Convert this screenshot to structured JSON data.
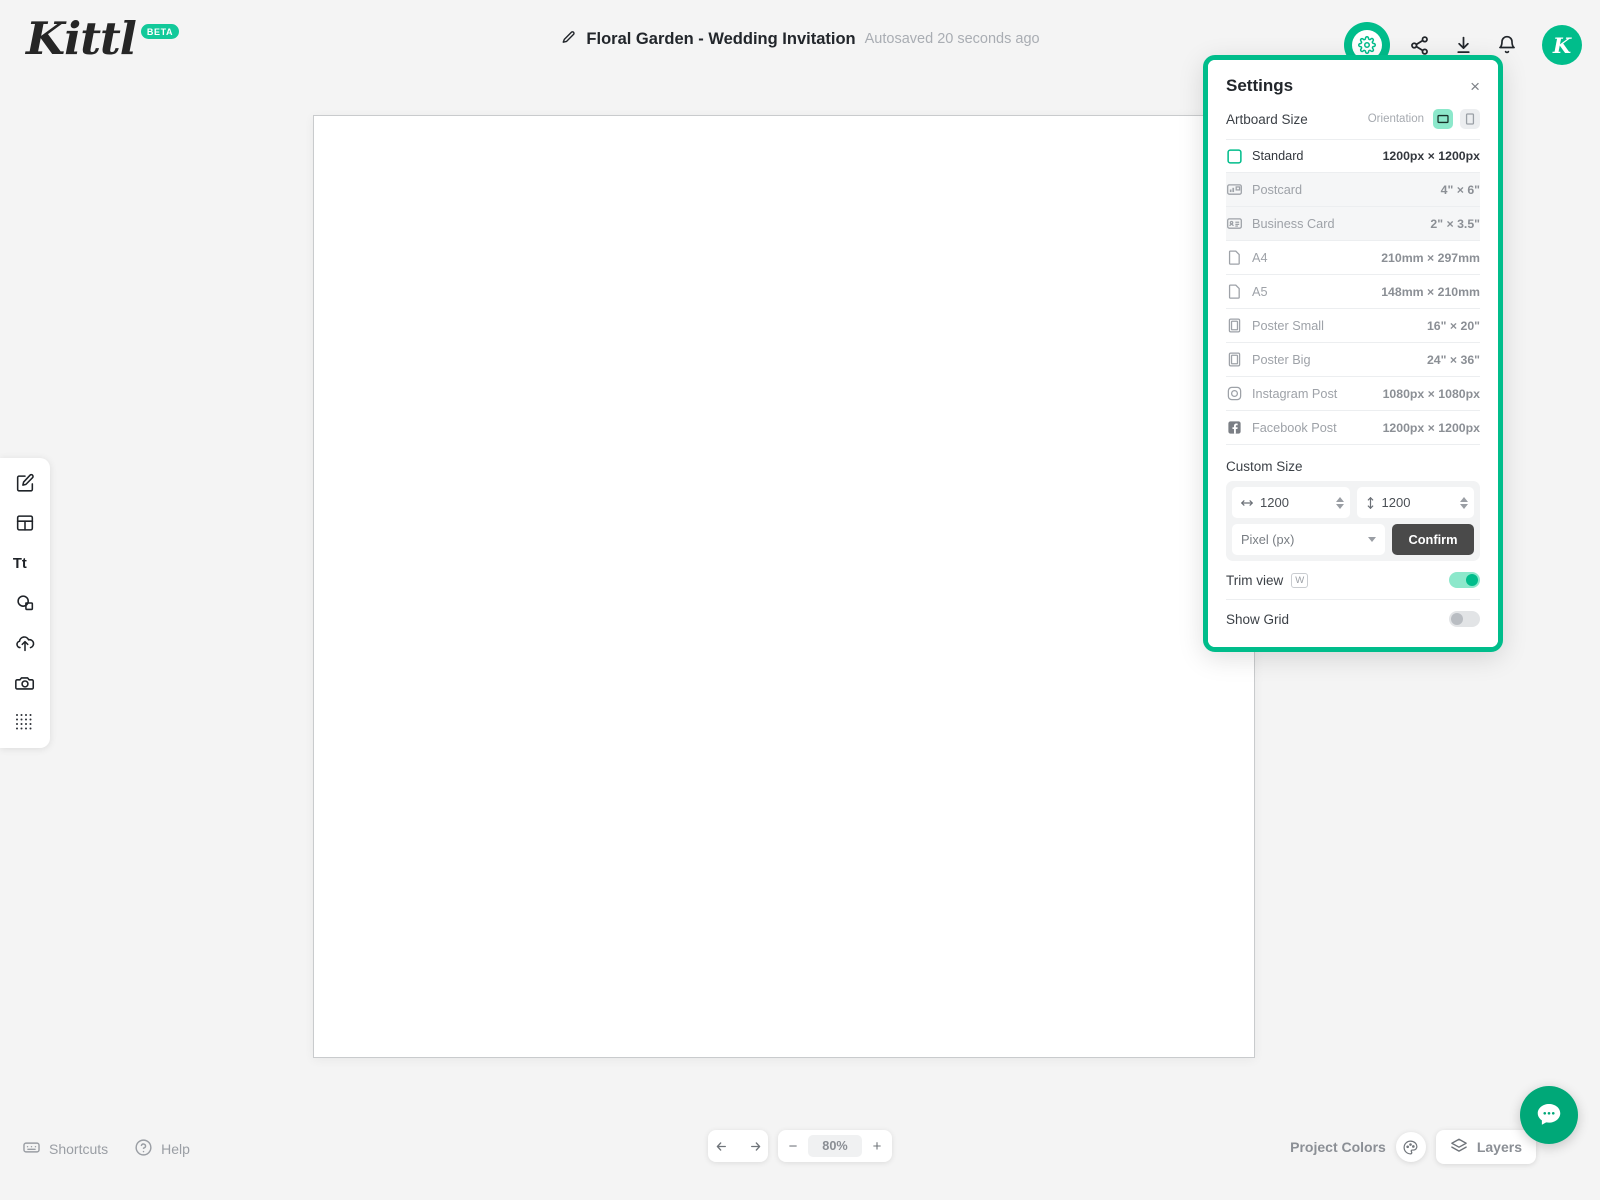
{
  "app": {
    "logo_text": "Kittl",
    "logo_badge": "BETA",
    "accent_color": "#00bd8b",
    "accent_light": "#8ce8cb"
  },
  "header": {
    "doc_title": "Floral Garden - Wedding Invitation",
    "autosave_status": "Autosaved 20 seconds ago",
    "edit_icon": "pencil-icon",
    "actions": [
      {
        "name": "settings-gear-icon",
        "label": "Settings"
      },
      {
        "name": "share-icon",
        "label": "Share"
      },
      {
        "name": "download-icon",
        "label": "Download"
      },
      {
        "name": "notifications-bell-icon",
        "label": "Notifications"
      }
    ],
    "avatar_initial": "K"
  },
  "left_toolbar": {
    "items": [
      {
        "name": "design-edit-icon",
        "label": "Design"
      },
      {
        "name": "templates-icon",
        "label": "Templates"
      },
      {
        "name": "text-icon",
        "label": "Text"
      },
      {
        "name": "elements-shapes-icon",
        "label": "Elements"
      },
      {
        "name": "upload-icon",
        "label": "Uploads"
      },
      {
        "name": "photos-camera-icon",
        "label": "Photos"
      },
      {
        "name": "patterns-grid-icon",
        "label": "Patterns"
      }
    ]
  },
  "settings_panel": {
    "title": "Settings",
    "close_label": "×",
    "artboard_size_label": "Artboard Size",
    "orientation_label": "Orientation",
    "orientation_options": [
      {
        "name": "orientation-landscape",
        "active": true
      },
      {
        "name": "orientation-portrait",
        "active": false
      }
    ],
    "sizes": [
      {
        "icon": "square-icon",
        "name": "Standard",
        "dimensions": "1200px × 1200px",
        "selected": true
      },
      {
        "icon": "postcard-icon",
        "name": "Postcard",
        "dimensions": "4\" × 6\"",
        "selected": false
      },
      {
        "icon": "business-card-icon",
        "name": "Business Card",
        "dimensions": "2\" × 3.5\"",
        "selected": false
      },
      {
        "icon": "page-icon",
        "name": "A4",
        "dimensions": "210mm × 297mm",
        "selected": false
      },
      {
        "icon": "page-icon",
        "name": "A5",
        "dimensions": "148mm × 210mm",
        "selected": false
      },
      {
        "icon": "poster-icon",
        "name": "Poster Small",
        "dimensions": "16\" × 20\"",
        "selected": false
      },
      {
        "icon": "poster-icon",
        "name": "Poster Big",
        "dimensions": "24\" × 36\"",
        "selected": false
      },
      {
        "icon": "instagram-icon",
        "name": "Instagram Post",
        "dimensions": "1080px × 1080px",
        "selected": false
      },
      {
        "icon": "facebook-icon",
        "name": "Facebook Post",
        "dimensions": "1200px × 1200px",
        "selected": false
      }
    ],
    "custom_size_label": "Custom Size",
    "width_value": "1200",
    "height_value": "1200",
    "unit_value": "Pixel (px)",
    "confirm_label": "Confirm",
    "trim_view": {
      "label": "Trim view",
      "shortcut": "W",
      "enabled": true
    },
    "show_grid": {
      "label": "Show Grid",
      "enabled": false
    }
  },
  "bottom_bar": {
    "shortcuts_label": "Shortcuts",
    "help_label": "Help",
    "undo_icon": "undo-arrow-icon",
    "redo_icon": "redo-arrow-icon",
    "zoom_out_label": "−",
    "zoom_value": "80%",
    "zoom_in_label": "+",
    "project_colors_label": "Project Colors",
    "layers_label": "Layers"
  }
}
